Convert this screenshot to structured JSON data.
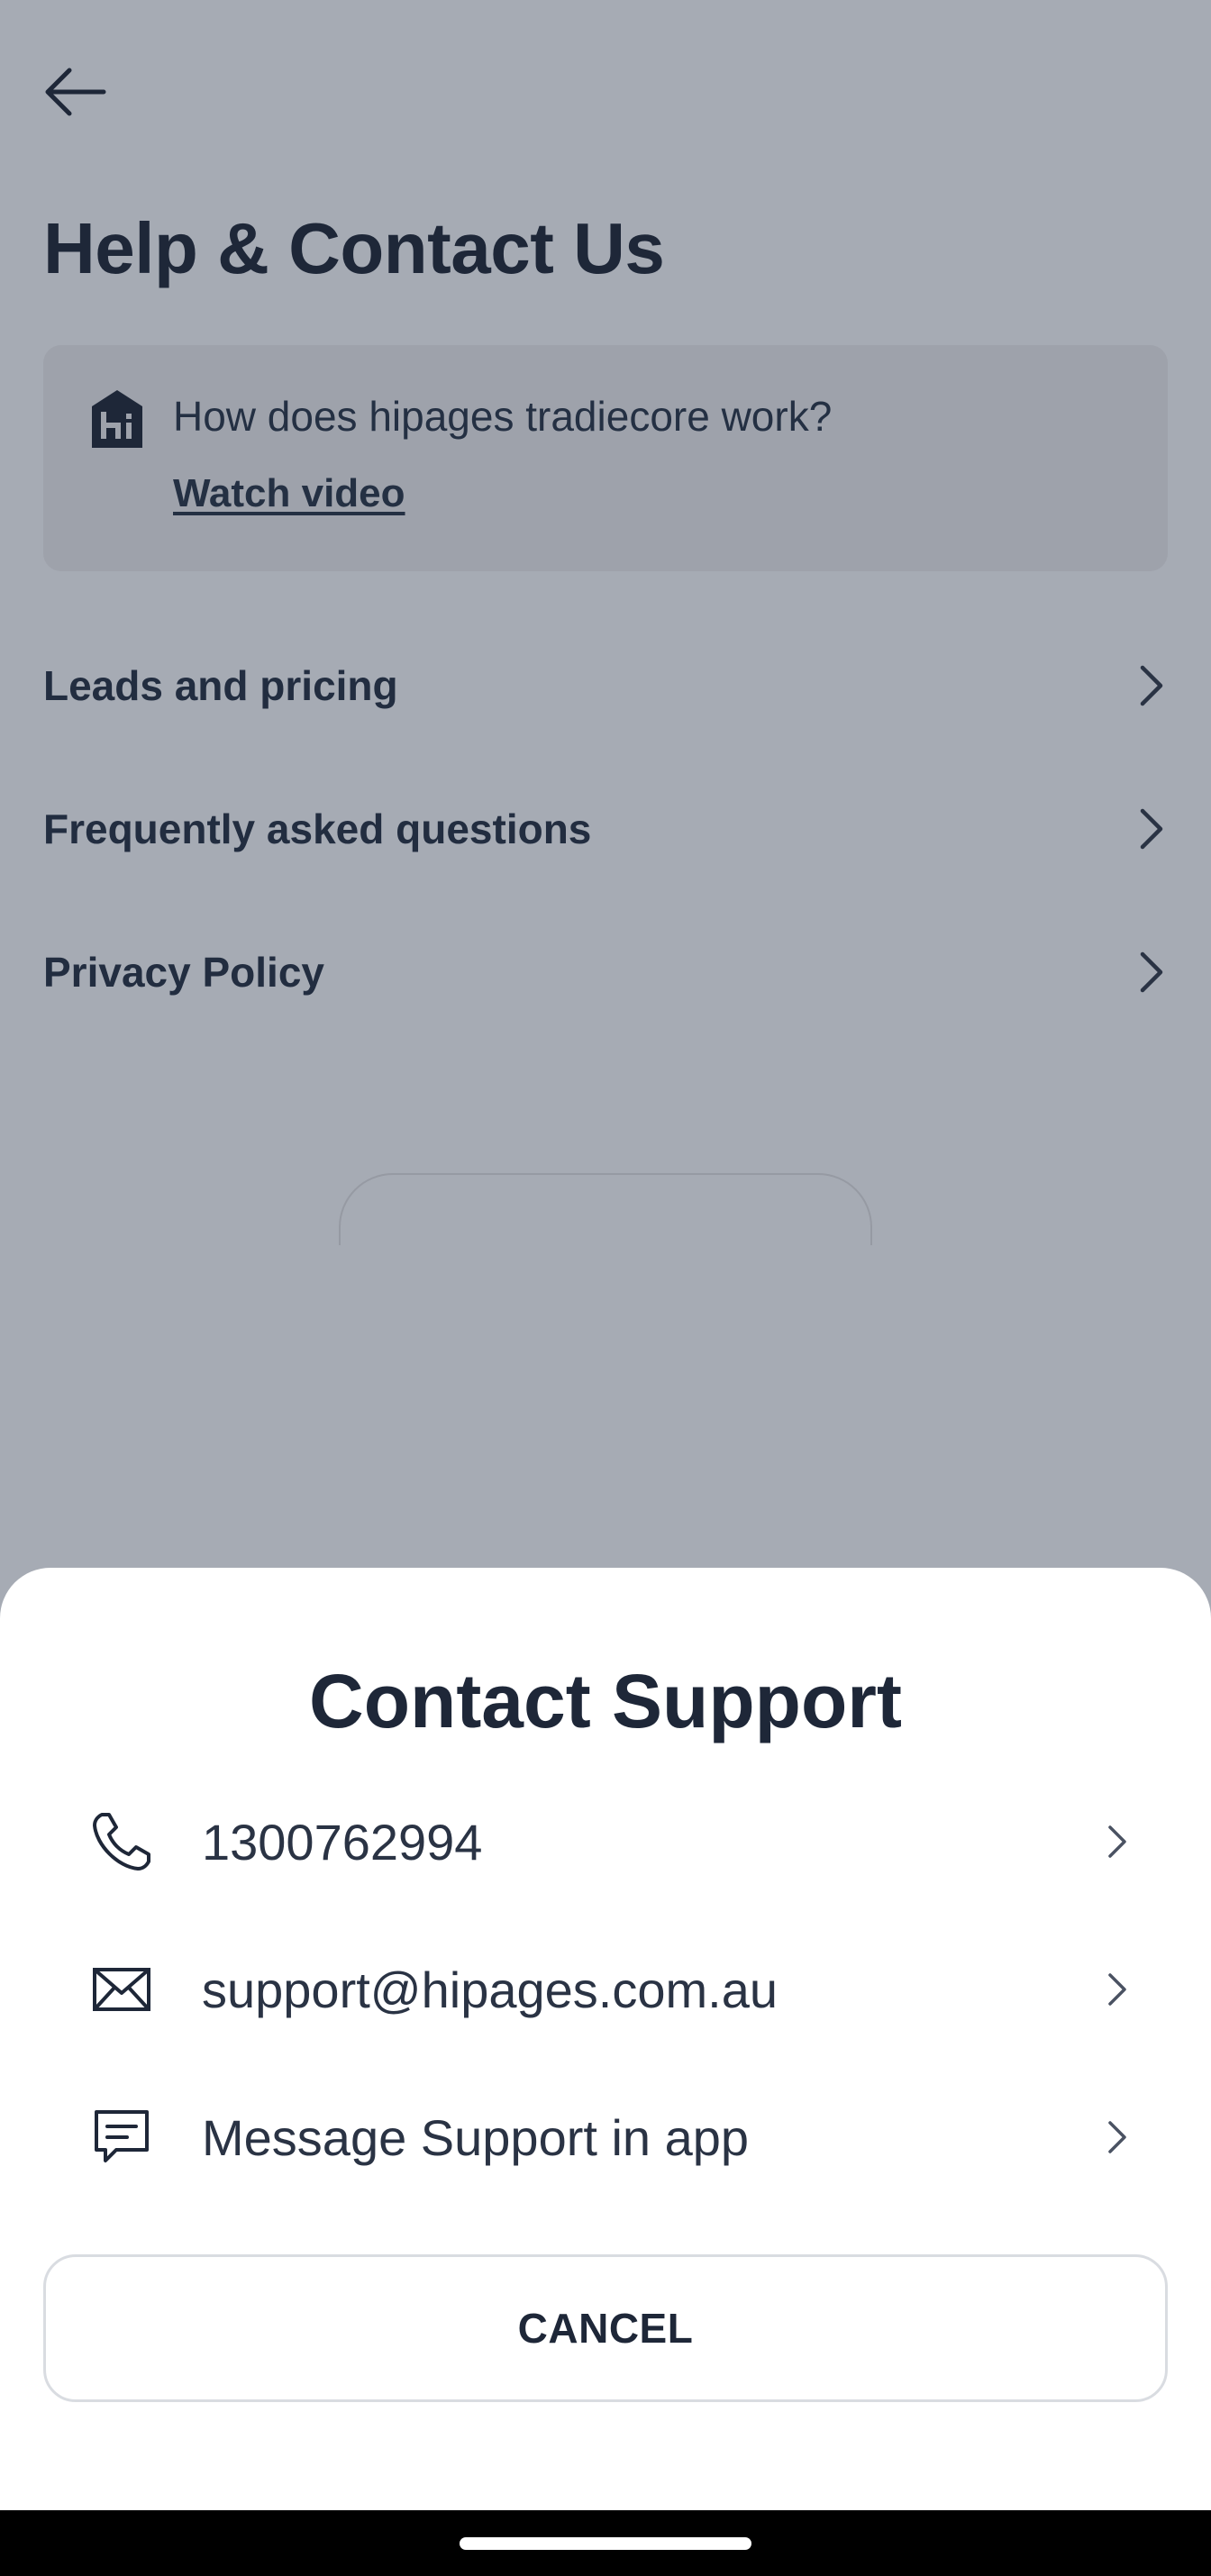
{
  "header": {
    "back_icon": "arrow-left-icon",
    "title": "Help & Contact Us"
  },
  "video_card": {
    "icon": "hipages-logo-icon",
    "question": "How does hipages tradiecore work?",
    "link": "Watch video"
  },
  "menu": {
    "items": [
      {
        "label": "Leads and pricing"
      },
      {
        "label": "Frequently asked questions"
      },
      {
        "label": "Privacy Policy"
      }
    ]
  },
  "sheet": {
    "title": "Contact Support",
    "options": [
      {
        "icon": "phone-icon",
        "label": "1300762994"
      },
      {
        "icon": "mail-icon",
        "label": "support@hipages.com.au"
      },
      {
        "icon": "message-icon",
        "label": "Message Support in app"
      }
    ],
    "cancel_label": "CANCEL"
  },
  "colors": {
    "overlay_background": "#a6abb4",
    "text_primary": "#1e2738",
    "sheet_background": "#ffffff"
  }
}
